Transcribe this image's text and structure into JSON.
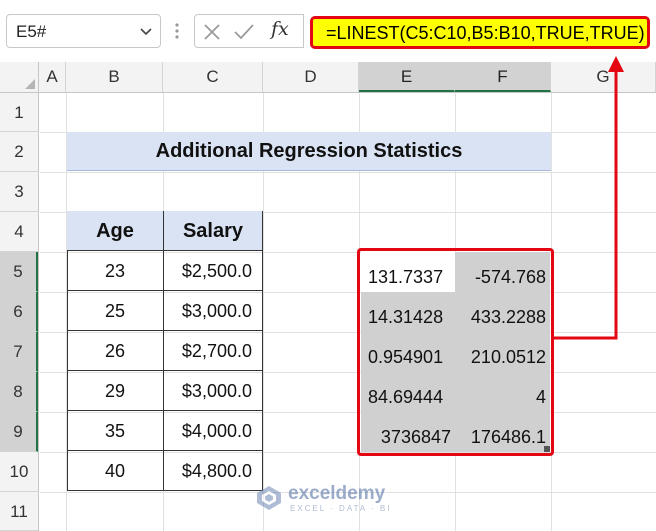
{
  "formula_bar": {
    "cell_ref": "E5#",
    "fx_label": "fx",
    "formula": "=LINEST(C5:C10,B5:B10,TRUE,TRUE)"
  },
  "columns": [
    "A",
    "B",
    "C",
    "D",
    "E",
    "F",
    "G"
  ],
  "selected_columns": [
    "E",
    "F"
  ],
  "rows": [
    "1",
    "2",
    "3",
    "4",
    "5",
    "6",
    "7",
    "8",
    "9",
    "10",
    "11"
  ],
  "selected_rows": [
    "5",
    "6",
    "7",
    "8",
    "9"
  ],
  "title": "Additional Regression Statistics",
  "table": {
    "headers": [
      "Age",
      "Salary"
    ],
    "rows": [
      {
        "age": "23",
        "salary": "$2,500.0"
      },
      {
        "age": "25",
        "salary": "$3,000.0"
      },
      {
        "age": "26",
        "salary": "$2,700.0"
      },
      {
        "age": "29",
        "salary": "$3,000.0"
      },
      {
        "age": "35",
        "salary": "$4,000.0"
      },
      {
        "age": "40",
        "salary": "$4,800.0"
      }
    ]
  },
  "output": [
    [
      "131.7337",
      "-574.768"
    ],
    [
      "14.31428",
      "433.2288"
    ],
    [
      "0.954901",
      "210.0512"
    ],
    [
      "84.69444",
      "4"
    ],
    [
      "3736847",
      "176486.1"
    ]
  ],
  "colors": {
    "highlight_border": "#e30613",
    "formula_fill": "#ffff00",
    "banner_fill": "#dae3f3",
    "output_fill": "#d0d0d0",
    "selection_green": "#217346"
  },
  "watermark": {
    "name": "exceldemy",
    "tagline": "EXCEL · DATA · BI"
  }
}
